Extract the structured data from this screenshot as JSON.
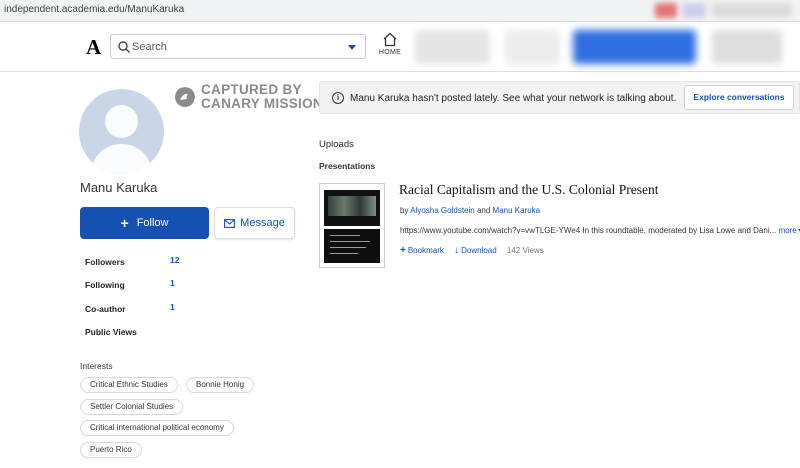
{
  "browser": {
    "url": "independent.academia.edu/ManuKaruka"
  },
  "nav": {
    "logo": "A",
    "search_placeholder": "Search",
    "home_label": "HOME"
  },
  "watermark": {
    "line1": "CAPTURED BY",
    "line2": "CANARY MISSION"
  },
  "profile": {
    "name": "Manu Karuka",
    "follow_label": "Follow",
    "message_label": "Message",
    "stats": [
      {
        "label": "Followers",
        "value": "12"
      },
      {
        "label": "Following",
        "value": "1"
      },
      {
        "label": "Co-author",
        "value": "1"
      },
      {
        "label": "Public Views",
        "value": ""
      }
    ],
    "interests_heading": "Interests",
    "interests": [
      "Critical Ethnic Studies",
      "Bonnie Honig",
      "Settler Colonial Studies",
      "Critical international political economy",
      "Puerto Rico"
    ]
  },
  "notice": {
    "text": "Manu Karuka hasn't posted lately. See what your network is talking about.",
    "button": "Explore conversations"
  },
  "content": {
    "uploads_heading": "Uploads",
    "section_heading": "Presentations",
    "item": {
      "title": "Racial Capitalism and the U.S. Colonial Present",
      "by": "by",
      "author1": "Alyosha Goldstein",
      "and": "and",
      "author2": "Manu Karuka",
      "description": "https://www.youtube.com/watch?v=vwTLGE-YWe4 In this roundtable, moderated by Lisa Lowe and Dani...",
      "more": "more",
      "bookmark": "Bookmark",
      "download": "Download",
      "views": "142 Views"
    }
  },
  "colors": {
    "accent": "#1551b0",
    "avatar_bg": "#c9d6e8"
  }
}
